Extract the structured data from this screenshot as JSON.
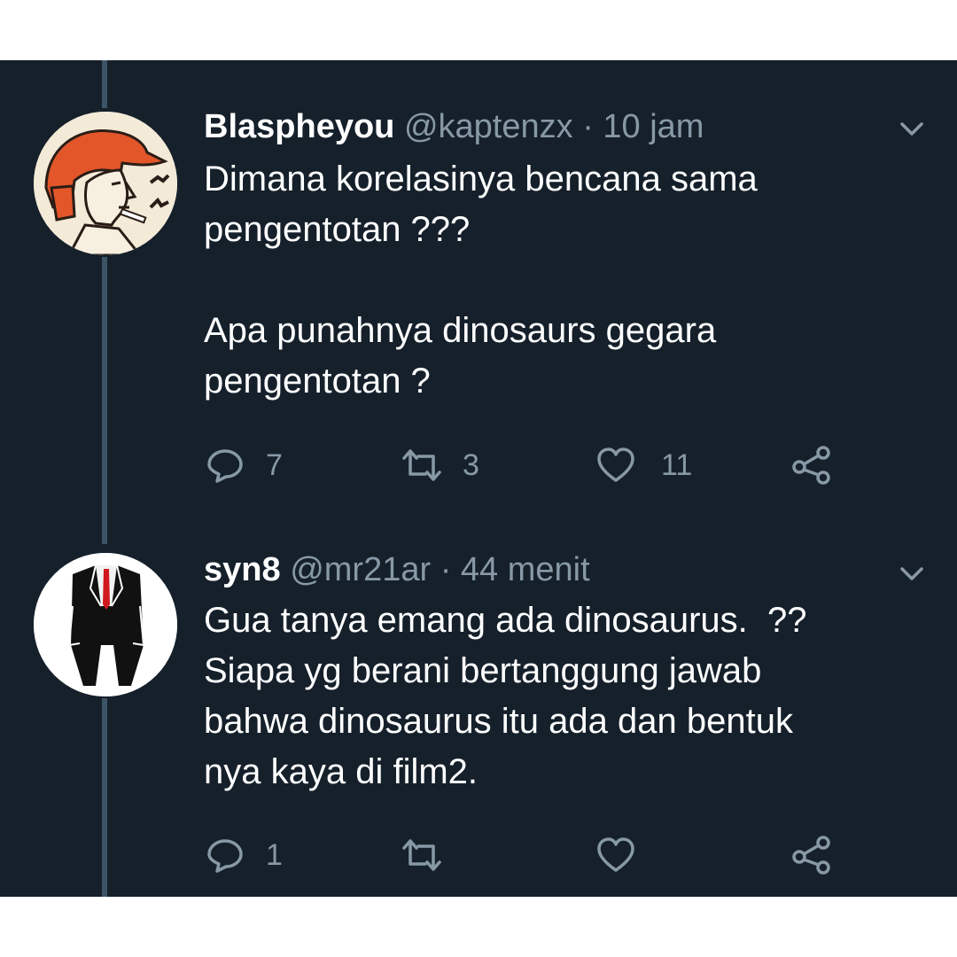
{
  "tweets": [
    {
      "name": "Blaspheyou",
      "handle": "@kaptenzx",
      "separator": "·",
      "time": "10 jam",
      "body": [
        "Dimana korelasinya bencana sama",
        "pengentotan ???",
        "",
        "Apa punahnya dinosaurs gegara",
        "pengentotan ?"
      ],
      "replies": "7",
      "retweets": "3",
      "likes": "11",
      "avatar": "cartoon-man-orange-cap"
    },
    {
      "name": "syn8",
      "handle": "@mr21ar",
      "separator": "·",
      "time": "44 menit",
      "body": [
        "Gua tanya emang ada dinosaurus.  ??",
        "Siapa yg berani bertanggung jawab",
        "bahwa dinosaurus itu ada dan bentuk",
        "nya kaya di film2."
      ],
      "replies": "1",
      "retweets": "",
      "likes": "",
      "avatar": "suit-red-tie-silhouette"
    }
  ],
  "icons": {
    "reply": "reply-icon",
    "retweet": "retweet-icon",
    "like": "heart-icon",
    "share": "share-icon",
    "menu": "chevron-down-icon"
  },
  "colors": {
    "background": "#15202b",
    "text": "#ffffff",
    "secondary": "#8899a6",
    "thread_line": "#3d5466"
  }
}
